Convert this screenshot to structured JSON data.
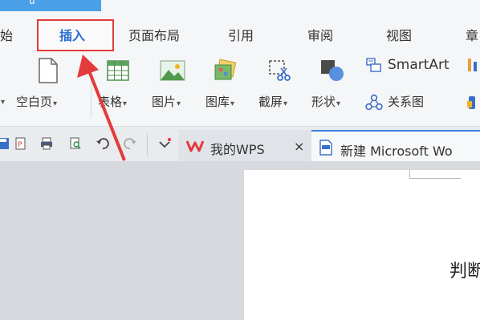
{
  "app": {
    "title_fragment": "ü"
  },
  "menu": {
    "items": [
      "始",
      "插入",
      "页面布局",
      "引用",
      "审阅",
      "视图",
      "章"
    ],
    "active": "插入"
  },
  "ribbon": {
    "blank_page": "空白页",
    "table": "表格",
    "picture": "图片",
    "gallery": "图库",
    "screenshot": "截屏",
    "shapes": "形状",
    "smartart": "SmartArt",
    "relation": "关系图"
  },
  "tabs": {
    "wps": "我的WPS",
    "close": "×",
    "doc": "新建 Microsoft Wo"
  },
  "document": {
    "text": "判断"
  },
  "colors": {
    "accent": "#2a6fd4",
    "highlight": "#e33b3b",
    "wps_logo": "#e33b3b",
    "tab_border": "#3d7fe0"
  }
}
